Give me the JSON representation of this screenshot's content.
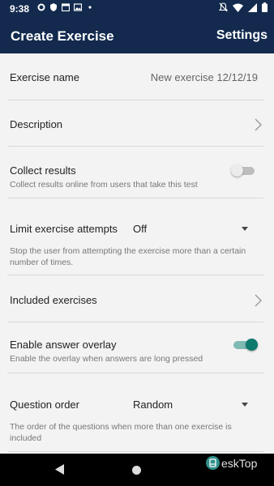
{
  "status_bar": {
    "time": "9:38",
    "left_icons": [
      "gear-icon",
      "shield-icon",
      "calendar-icon",
      "image-icon",
      "dot-icon"
    ],
    "right_icons": [
      "mute-icon",
      "wifi-icon",
      "signal-icon",
      "battery-icon"
    ]
  },
  "app_bar": {
    "title": "Create Exercise",
    "settings_label": "Settings",
    "background": "#132a4e"
  },
  "settings": {
    "exercise_name": {
      "label": "Exercise name",
      "value": "New exercise 12/12/19"
    },
    "description": {
      "label": "Description"
    },
    "collect_results": {
      "label": "Collect results",
      "sub": "Collect results online from users that take this test",
      "enabled": false
    },
    "limit_attempts": {
      "label": "Limit exercise attempts",
      "value": "Off",
      "sub": "Stop the user from attempting the exercise more than a certain number of times."
    },
    "included_exercises": {
      "label": "Included exercises"
    },
    "answer_overlay": {
      "label": "Enable answer overlay",
      "sub": "Enable the overlay when answers are long pressed",
      "enabled": true
    },
    "question_order": {
      "label": "Question order",
      "value": "Random",
      "sub": "The order of the questions when more than one exercise is included"
    }
  },
  "colors": {
    "accent": "#0f7a6e",
    "accent_track": "#7fbab3",
    "toggle_off_thumb": "#ececec",
    "toggle_off_track": "#bdbdbd"
  },
  "watermark": {
    "text": "eskTop"
  }
}
